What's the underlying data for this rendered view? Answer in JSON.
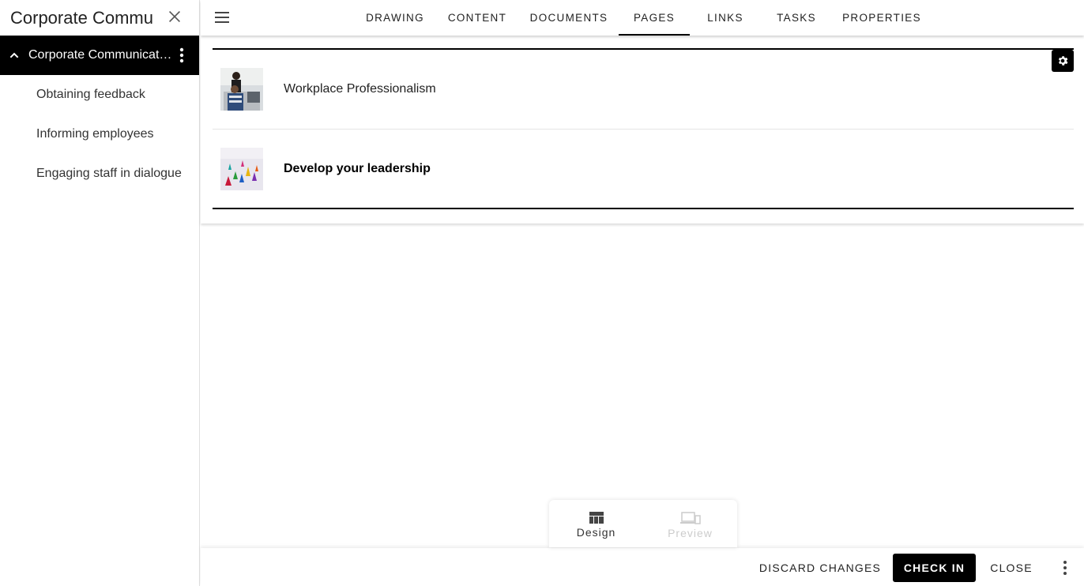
{
  "sidebar": {
    "title": "Corporate Communications",
    "active_item": "Corporate Communications",
    "items": [
      {
        "label": "Obtaining feedback"
      },
      {
        "label": "Informing employees"
      },
      {
        "label": "Engaging staff in dialogue"
      }
    ]
  },
  "tabs": [
    {
      "label": "DRAWING"
    },
    {
      "label": "CONTENT"
    },
    {
      "label": "DOCUMENTS"
    },
    {
      "label": "PAGES",
      "active": true
    },
    {
      "label": "LINKS"
    },
    {
      "label": "TASKS"
    },
    {
      "label": "PROPERTIES"
    }
  ],
  "pages": [
    {
      "label": "Workplace Professionalism",
      "bold": false
    },
    {
      "label": "Develop your leadership",
      "bold": true
    }
  ],
  "modes": {
    "design_label": "Design",
    "preview_label": "Preview"
  },
  "footer": {
    "discard_label": "DISCARD CHANGES",
    "checkin_label": "CHECK IN",
    "close_label": "CLOSE"
  },
  "icons": {
    "sidebar_close": "close-icon",
    "sidebar_expand": "chevron-up-icon",
    "menu": "hamburger-menu-icon",
    "settings": "gear-icon",
    "more": "more-vert-icon",
    "design": "dashboard-icon",
    "preview": "devices-icon"
  },
  "colors": {
    "active_bg": "#000000",
    "primary_button": "#000000",
    "preview_disabled": "#cccccc"
  }
}
